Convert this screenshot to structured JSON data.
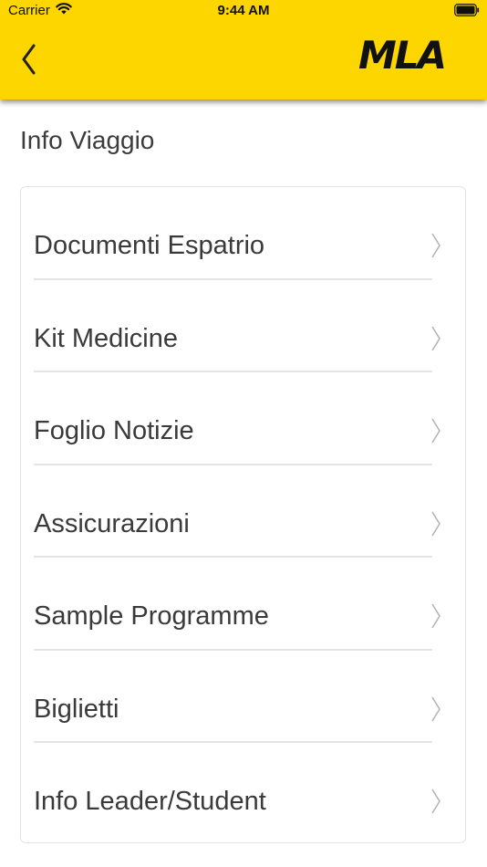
{
  "status_bar": {
    "carrier": "Carrier",
    "time": "9:44 AM",
    "wifi_icon": "wifi-icon",
    "battery_icon": "battery-full-icon"
  },
  "nav": {
    "back_icon": "chevron-left-icon",
    "logo_text": "MLA",
    "bar_color": "#fdd600"
  },
  "section": {
    "title": "Info Viaggio"
  },
  "menu": {
    "items": [
      {
        "label": "Documenti Espatrio"
      },
      {
        "label": "Kit Medicine"
      },
      {
        "label": "Foglio Notizie"
      },
      {
        "label": "Assicurazioni"
      },
      {
        "label": "Sample Programme"
      },
      {
        "label": "Biglietti"
      },
      {
        "label": "Info Leader/Student"
      }
    ],
    "chevron_icon": "chevron-right-icon"
  }
}
